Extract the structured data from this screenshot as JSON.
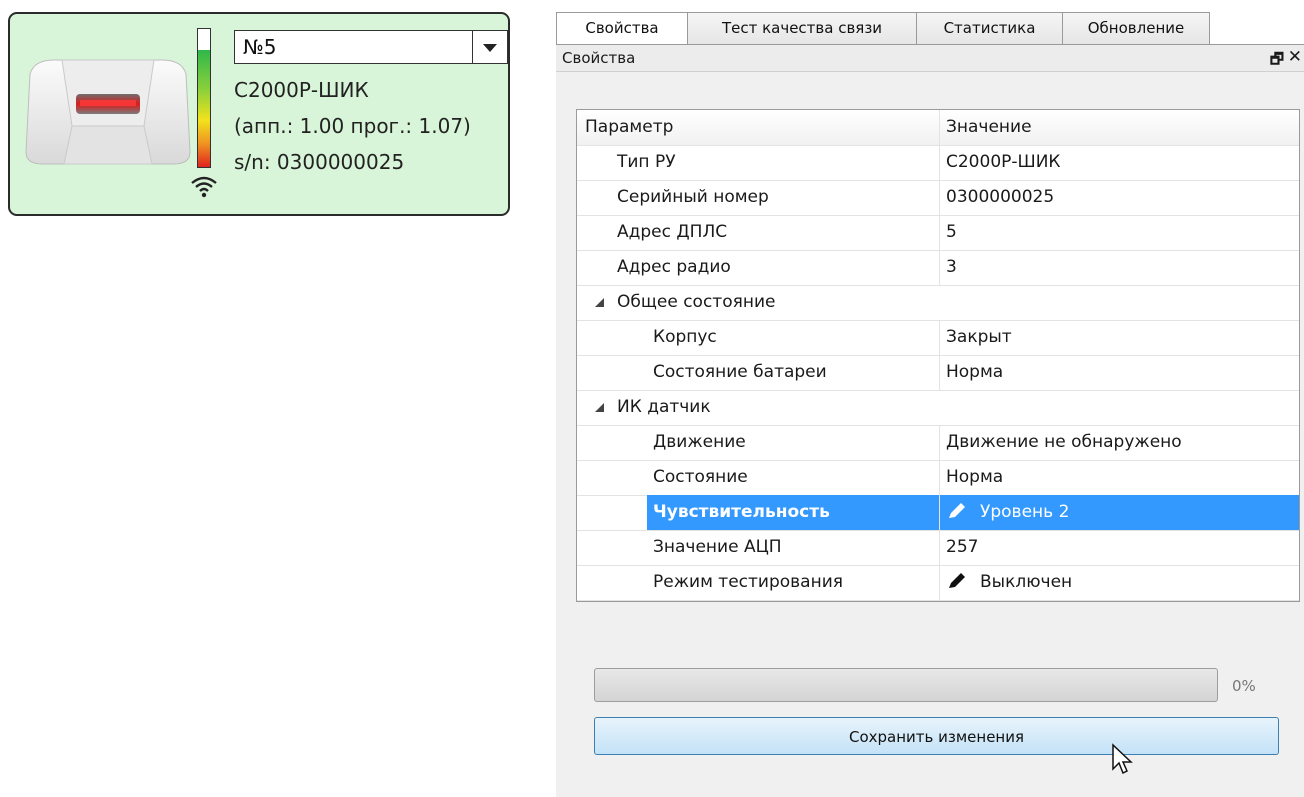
{
  "device": {
    "address": "№5",
    "model": "С2000Р-ШИК",
    "versions": "(апп.: 1.00 прог.: 1.07)",
    "serial": "s/n: 0300000025",
    "signal_level": 0.85
  },
  "tabs": [
    {
      "label": "Свойства",
      "active": true
    },
    {
      "label": "Тест качества связи",
      "active": false
    },
    {
      "label": "Статистика",
      "active": false
    },
    {
      "label": "Обновление",
      "active": false
    }
  ],
  "panel": {
    "title": "Свойства"
  },
  "grid": {
    "headers": [
      "Параметр",
      "Значение"
    ],
    "rows": [
      {
        "name": "Тип РУ",
        "value": "С2000Р-ШИК"
      },
      {
        "name": "Серийный номер",
        "value": "0300000025"
      },
      {
        "name": "Адрес ДПЛС",
        "value": "5"
      },
      {
        "name": "Адрес радио",
        "value": "3"
      },
      {
        "name": "Общее состояние",
        "value": ""
      },
      {
        "name": "Корпус",
        "value": "Закрыт"
      },
      {
        "name": "Состояние батареи",
        "value": "Норма"
      },
      {
        "name": "ИК датчик",
        "value": ""
      },
      {
        "name": "Движение",
        "value": "Движение не обнаружено"
      },
      {
        "name": "Состояние",
        "value": "Норма"
      },
      {
        "name": "Чувствительность",
        "value": "Уровень 2"
      },
      {
        "name": "Значение АЦП",
        "value": "257"
      },
      {
        "name": "Режим тестирования",
        "value": "Выключен"
      }
    ]
  },
  "progress": {
    "value": 0,
    "label": "0%"
  },
  "save_label": "Сохранить изменения",
  "colors": {
    "card_bg": "#d9f5d9",
    "selection": "#3399ff",
    "button": "#c4e2f7"
  }
}
